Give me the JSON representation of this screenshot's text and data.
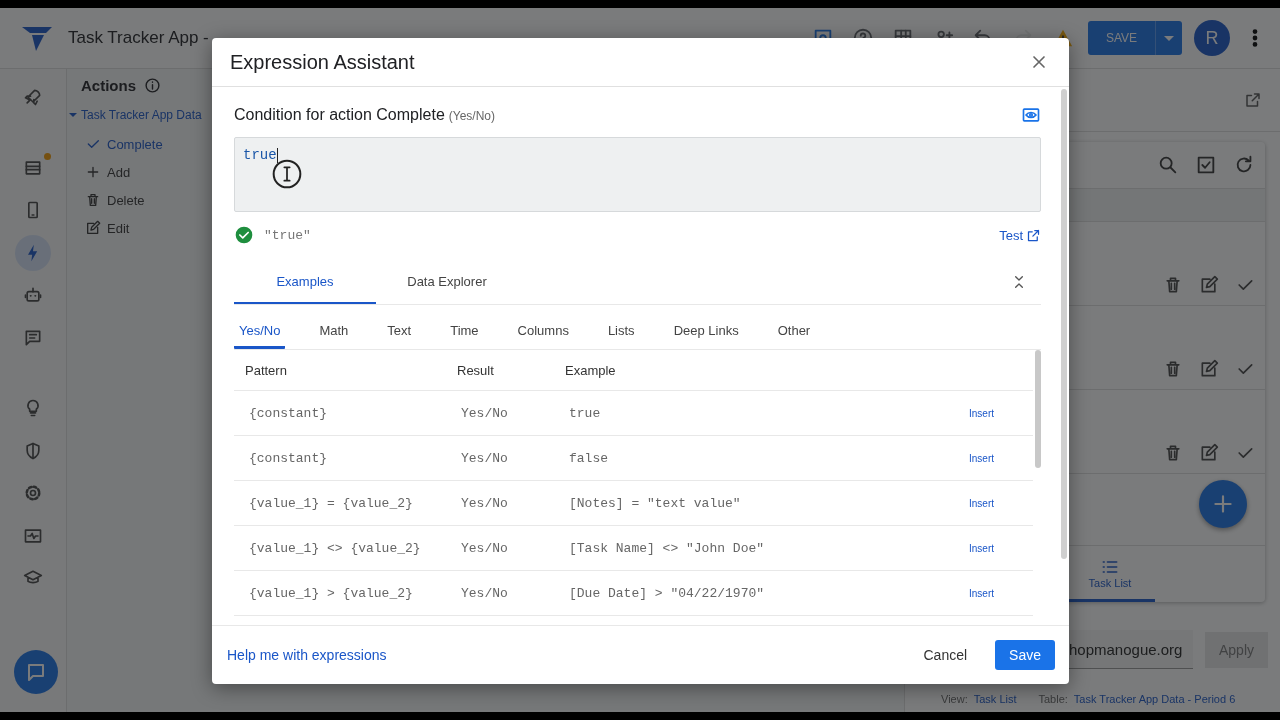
{
  "app_bar": {
    "title": "Task Tracker App -",
    "toolbar": [
      {
        "kind": "preview",
        "disabled": false
      },
      {
        "kind": "help",
        "disabled": false
      },
      {
        "kind": "grid",
        "disabled": false
      },
      {
        "kind": "personadd",
        "disabled": false
      },
      {
        "kind": "undo",
        "disabled": false
      },
      {
        "kind": "redo",
        "disabled": true
      },
      {
        "kind": "warning",
        "disabled": false
      }
    ],
    "save_button": "SAVE",
    "avatar": "R"
  },
  "nav_rail": [
    {
      "kind": "rocket",
      "selected": false,
      "notified": false
    },
    {
      "kind": "table",
      "selected": false,
      "notified": true
    },
    {
      "kind": "phone",
      "selected": false,
      "notified": false
    },
    {
      "kind": "bolt",
      "selected": true,
      "notified": false
    },
    {
      "kind": "robot",
      "selected": false,
      "notified": false
    },
    {
      "kind": "chat",
      "selected": false,
      "notified": false
    },
    {
      "kind": "bulb",
      "selected": false,
      "notified": false
    },
    {
      "kind": "shield",
      "selected": false,
      "notified": false
    },
    {
      "kind": "gear",
      "selected": false,
      "notified": false
    },
    {
      "kind": "pulse",
      "selected": false,
      "notified": false
    },
    {
      "kind": "cap",
      "selected": false,
      "notified": false
    }
  ],
  "actions_panel": {
    "title": "Actions",
    "tree": [
      {
        "label": "Task Tracker App Data",
        "expanded": true,
        "children": [
          {
            "label": "Complete",
            "kind": "check",
            "selected": true
          },
          {
            "label": "Add",
            "kind": "plus",
            "selected": false
          },
          {
            "label": "Delete",
            "kind": "trash",
            "selected": false
          },
          {
            "label": "Edit",
            "kind": "edit",
            "selected": false
          }
        ]
      }
    ]
  },
  "preview": {
    "nav": [
      {
        "label": "Task List",
        "selected": true
      }
    ],
    "domain_field": "hopmanogue.org",
    "apply_button": {
      "label": "Apply",
      "disabled": true
    },
    "view_label": "View:",
    "view": "Task List",
    "table_label": "Table:",
    "table": "Task Tracker App Data - Period 6"
  },
  "dialog": {
    "title": "Expression Assistant",
    "condition_label": "Condition for action Complete",
    "condition_type": "(Yes/No)",
    "expression": "true",
    "result": "\"true\"",
    "valid": true,
    "test_link": "Test",
    "tabs": [
      {
        "label": "Examples",
        "selected": true
      },
      {
        "label": "Data Explorer",
        "selected": false
      }
    ],
    "categories": [
      {
        "label": "Yes/No",
        "selected": true
      },
      {
        "label": "Math",
        "selected": false
      },
      {
        "label": "Text",
        "selected": false
      },
      {
        "label": "Time",
        "selected": false
      },
      {
        "label": "Columns",
        "selected": false
      },
      {
        "label": "Lists",
        "selected": false
      },
      {
        "label": "Deep Links",
        "selected": false
      },
      {
        "label": "Other",
        "selected": false
      }
    ],
    "table": {
      "columns": [
        "Pattern",
        "Result",
        "Example"
      ],
      "rows": [
        {
          "pattern": "{constant}",
          "result": "Yes/No",
          "example": "true",
          "action": "Insert"
        },
        {
          "pattern": "{constant}",
          "result": "Yes/No",
          "example": "false",
          "action": "Insert"
        },
        {
          "pattern": "{value_1} = {value_2}",
          "result": "Yes/No",
          "example": "[Notes] = \"text value\"",
          "action": "Insert"
        },
        {
          "pattern": "{value_1} <> {value_2}",
          "result": "Yes/No",
          "example": "[Task Name] <> \"John Doe\"",
          "action": "Insert"
        },
        {
          "pattern": "{value_1} > {value_2}",
          "result": "Yes/No",
          "example": "[Due Date] > \"04/22/1970\"",
          "action": "Insert"
        }
      ]
    },
    "help_link": "Help me with expressions",
    "buttons": [
      {
        "label": "Cancel",
        "kind": "text"
      },
      {
        "label": "Save",
        "kind": "primary"
      }
    ]
  }
}
